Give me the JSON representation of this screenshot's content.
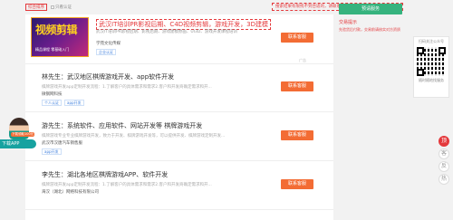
{
  "filter": {
    "box_label": "综合排序",
    "checkbox_label": "只看认证"
  },
  "search_hint": "搜索结果有限找不到合适的，请联系400平台沟通",
  "ad": {
    "thumb_big": "视频剪辑",
    "thumb_sub": "精品课程 零基础入门",
    "title": "武汉IT培训PR影视后期、C4D视频剪辑，游戏开发，3D建模",
    "desc": "武汉IT培训PR影视后期、影视后期、游戏建模原画、UI3D、游戏开发课程培训",
    "company": "学苑文化传媒",
    "tags": [
      "企业认证"
    ],
    "label": "广告",
    "button": "联系客服"
  },
  "items": [
    {
      "title": "林先生：武汉地区棋牌游戏开发、app软件开发",
      "desc": "棋牌游戏开发app定制开发流程：1.了解客户的具体需求和需求2.客户和开发商确定需求和开...",
      "company": "微钢网科技",
      "tags": [
        "个人认证",
        "app开发"
      ],
      "button": "联系客服"
    },
    {
      "title": "游先生：系统软件、应用软件、网站开发等 棋牌游戏开发",
      "desc": "棋牌游戏专业专业棋牌游戏开发，致力于开发、棋牌游戏开发等，可以提供开发、棋牌游戏定制开发...",
      "company": "武汉市汉唐汽车销售服",
      "tags": [
        "app开发"
      ],
      "button": "联系客服"
    },
    {
      "title": "李先生：湖北各地区棋牌游戏APP、软件开发",
      "desc": "棋牌游戏开发app定制开发流程：1.了解客户的具体需求和需求2.客户和开发商确定需求和开...",
      "company": "海汉（湖北）网络科技有限公司",
      "tags": [],
      "button": "联系客服"
    }
  ],
  "right": {
    "verify_button": "预请服务",
    "warn_title": "交易提示",
    "warn_desc": "先验货后付款，交易前请核实对方资质"
  },
  "qr": {
    "caption": "扫码关注公众号",
    "foot": "随时随地找服务"
  },
  "app_promo": {
    "badge": "下载领取100元",
    "bar": "下载APP"
  },
  "tools": [
    "顶",
    "客",
    "反",
    "热"
  ]
}
